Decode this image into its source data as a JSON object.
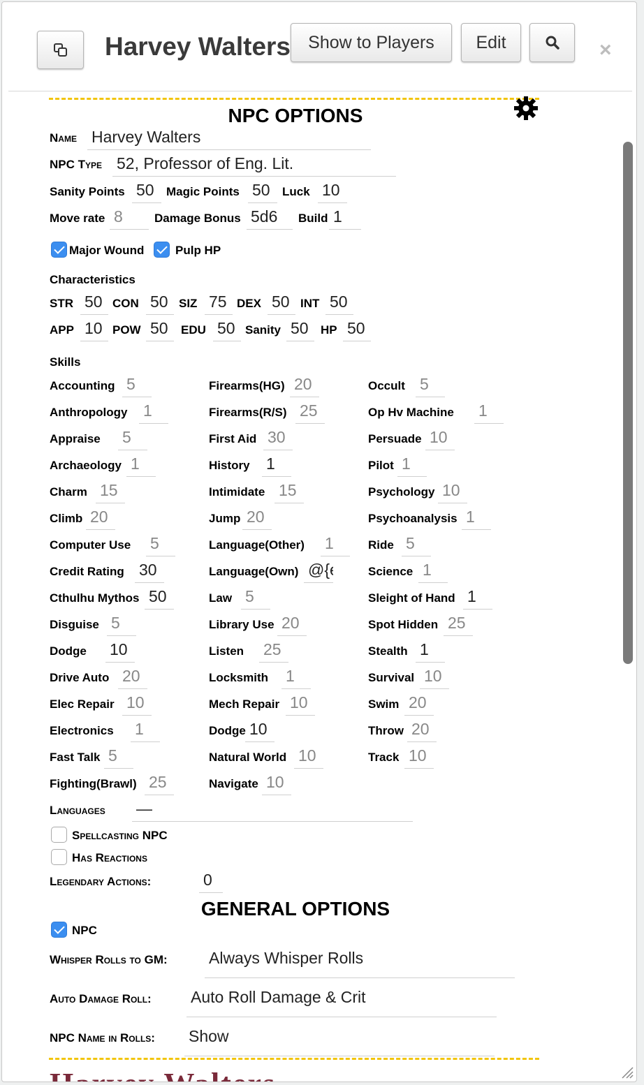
{
  "window": {
    "title": "Harvey Walters",
    "show_button": "Show to Players",
    "edit_button": "Edit",
    "close_glyph": "×"
  },
  "npc": {
    "heading": "NPC OPTIONS",
    "name_label": "Name",
    "name": "Harvey Walters",
    "type_label": "NPC Type",
    "type": "52, Professor of Eng. Lit.",
    "sanity_label": "Sanity Points",
    "sanity": "50",
    "magic_label": "Magic Points",
    "magic": "50",
    "luck_label": "Luck",
    "luck": "10",
    "move_label": "Move rate",
    "move": "8",
    "damage_label": "Damage Bonus",
    "damage": "5d6",
    "build_label": "Build",
    "build": "1",
    "major_wound_label": "Major Wound",
    "major_wound": true,
    "pulp_hp_label": "Pulp HP",
    "pulp_hp": true,
    "characteristics_label": "Characteristics",
    "chars": [
      {
        "label": "STR",
        "value": "50"
      },
      {
        "label": "CON",
        "value": "50"
      },
      {
        "label": "SIZ",
        "value": "75"
      },
      {
        "label": "DEX",
        "value": "50"
      },
      {
        "label": "INT",
        "value": "50"
      },
      {
        "label": "APP",
        "value": "10"
      },
      {
        "label": "POW",
        "value": "50"
      },
      {
        "label": "EDU",
        "value": "50"
      },
      {
        "label": "Sanity",
        "value": "50"
      },
      {
        "label": "HP",
        "value": "50"
      }
    ],
    "skills_label": "Skills",
    "skills": [
      [
        {
          "n": "Accounting",
          "v": "5",
          "d": false
        },
        {
          "n": "Anthropology",
          "v": "1",
          "d": false
        },
        {
          "n": "Appraise",
          "v": "5",
          "d": false
        },
        {
          "n": "Archaeology",
          "v": "1",
          "d": false
        },
        {
          "n": "Charm",
          "v": "15",
          "d": false
        },
        {
          "n": "Climb",
          "v": "20",
          "d": false
        },
        {
          "n": "Computer Use",
          "v": "5",
          "d": false
        },
        {
          "n": "Credit Rating",
          "v": "30",
          "d": true
        },
        {
          "n": "Cthulhu Mythos",
          "v": "50",
          "d": true
        },
        {
          "n": "Disguise",
          "v": "5",
          "d": false
        },
        {
          "n": "Dodge",
          "v": "10",
          "d": true
        },
        {
          "n": "Drive Auto",
          "v": "20",
          "d": false
        },
        {
          "n": "Elec Repair",
          "v": "10",
          "d": false
        },
        {
          "n": "Electronics",
          "v": "1",
          "d": false
        },
        {
          "n": "Fast Talk",
          "v": "5",
          "d": false
        },
        {
          "n": "Fighting(Brawl)",
          "v": "25",
          "d": false
        }
      ],
      [
        {
          "n": "Firearms(HG)",
          "v": "20",
          "d": false
        },
        {
          "n": "Firearms(R/S)",
          "v": "25",
          "d": false
        },
        {
          "n": "First Aid",
          "v": "30",
          "d": false
        },
        {
          "n": "History",
          "v": "1",
          "d": true
        },
        {
          "n": "Intimidate",
          "v": "15",
          "d": false
        },
        {
          "n": "Jump",
          "v": "20",
          "d": false
        },
        {
          "n": "Language(Other)",
          "v": "1",
          "d": false
        },
        {
          "n": "Language(Own)",
          "v": "@{e",
          "d": true
        },
        {
          "n": "Law",
          "v": "5",
          "d": false
        },
        {
          "n": "Library Use",
          "v": "20",
          "d": false
        },
        {
          "n": "Listen",
          "v": "25",
          "d": false
        },
        {
          "n": "Locksmith",
          "v": "1",
          "d": false
        },
        {
          "n": "Mech Repair",
          "v": "10",
          "d": false
        },
        {
          "n": "Dodge",
          "v": "10",
          "d": true
        },
        {
          "n": "Natural World",
          "v": "10",
          "d": false
        },
        {
          "n": "Navigate",
          "v": "10",
          "d": false
        }
      ],
      [
        {
          "n": "Occult",
          "v": "5",
          "d": false
        },
        {
          "n": "Op Hv Machine",
          "v": "1",
          "d": false
        },
        {
          "n": "Persuade",
          "v": "10",
          "d": false
        },
        {
          "n": "Pilot",
          "v": "1",
          "d": false
        },
        {
          "n": "Psychology",
          "v": "10",
          "d": false
        },
        {
          "n": "Psychoanalysis",
          "v": "1",
          "d": false
        },
        {
          "n": "Ride",
          "v": "5",
          "d": false
        },
        {
          "n": "Science",
          "v": "1",
          "d": false
        },
        {
          "n": "Sleight of Hand",
          "v": "1",
          "d": true
        },
        {
          "n": "Spot Hidden",
          "v": "25",
          "d": false
        },
        {
          "n": "Stealth",
          "v": "1",
          "d": true
        },
        {
          "n": "Survival",
          "v": "10",
          "d": false
        },
        {
          "n": "Swim",
          "v": "20",
          "d": false
        },
        {
          "n": "Throw",
          "v": "20",
          "d": false
        },
        {
          "n": "Track",
          "v": "10",
          "d": false
        }
      ]
    ],
    "languages_label": "Languages",
    "languages": "—",
    "spellcasting_label": "Spellcasting NPC",
    "spellcasting": false,
    "reactions_label": "Has Reactions",
    "reactions": false,
    "legendary_label": "Legendary Actions:",
    "legendary": "0"
  },
  "general": {
    "heading": "GENERAL OPTIONS",
    "npc_label": "NPC",
    "npc": true,
    "whisper_label": "Whisper Rolls to GM:",
    "whisper": "Always Whisper Rolls",
    "auto_damage_label": "Auto Damage Roll:",
    "auto_damage": "Auto Roll Damage & Crit",
    "name_in_rolls_label": "NPC Name in Rolls:",
    "name_in_rolls": "Show"
  },
  "footer_title": "Harvey Walters",
  "icons": {
    "popout": "popout-icon",
    "search": "search-icon",
    "gear": "gear-icon",
    "close": "close-icon"
  },
  "colors": {
    "dash": "#f2c50c",
    "checkbox": "#3b8ef0",
    "footer_title": "#7a2a3a"
  }
}
